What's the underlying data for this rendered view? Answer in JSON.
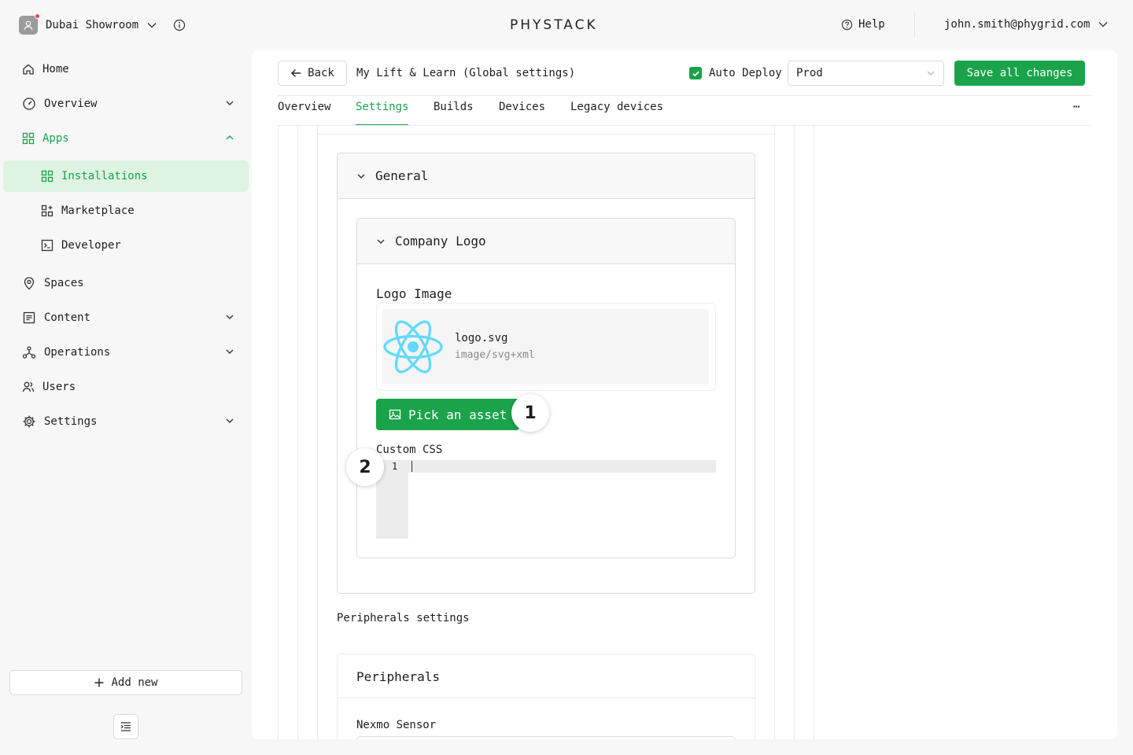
{
  "workspace": {
    "name": "Dubai Showroom"
  },
  "brand": {
    "logo_text": "PHYSTACK"
  },
  "header": {
    "help_label": "Help",
    "user_email": "john.smith@phygrid.com"
  },
  "sidebar": {
    "items": [
      {
        "label": "Home"
      },
      {
        "label": "Overview"
      },
      {
        "label": "Apps"
      },
      {
        "label": "Installations"
      },
      {
        "label": "Marketplace"
      },
      {
        "label": "Developer"
      },
      {
        "label": "Spaces"
      },
      {
        "label": "Content"
      },
      {
        "label": "Operations"
      },
      {
        "label": "Users"
      },
      {
        "label": "Settings"
      }
    ],
    "add_new_label": "Add new"
  },
  "toolbar": {
    "back_label": "Back",
    "title": "My Lift & Learn (Global settings)",
    "auto_deploy_label": "Auto Deploy",
    "auto_deploy_checked": true,
    "environment": "Prod",
    "save_label": "Save all changes"
  },
  "tabs": [
    {
      "label": "Overview",
      "active": false
    },
    {
      "label": "Settings",
      "active": true
    },
    {
      "label": "Builds",
      "active": false
    },
    {
      "label": "Devices",
      "active": false
    },
    {
      "label": "Legacy devices",
      "active": false
    }
  ],
  "settings": {
    "general_title": "General",
    "company_logo_title": "Company Logo",
    "logo_image_label": "Logo Image",
    "asset": {
      "filename": "logo.svg",
      "mimetype": "image/svg+xml"
    },
    "pick_asset_label": "Pick an asset",
    "custom_css_label": "Custom CSS",
    "editor_line_number": "1",
    "peripherals_settings_label": "Peripherals settings",
    "peripherals_title": "Peripherals",
    "nexmo_label": "Nexmo Sensor"
  },
  "annotations": {
    "marker_1": "1",
    "marker_2": "2"
  },
  "colors": {
    "accent": "#1aa34a",
    "accent_bg": "#dff3e3",
    "react_logo": "#61dafb"
  }
}
